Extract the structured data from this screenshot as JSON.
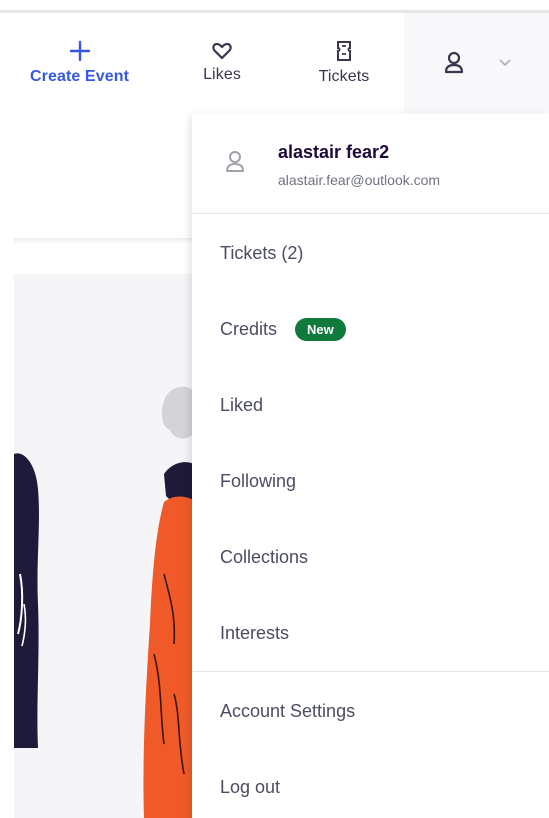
{
  "header": {
    "create_event": "Create Event",
    "likes": "Likes",
    "tickets": "Tickets"
  },
  "icons": {
    "create": "plus-icon",
    "likes": "heart-icon",
    "tickets": "ticket-icon",
    "profile": "user-icon",
    "chevron": "chevron-down-icon"
  },
  "colors": {
    "accent_blue": "#3659e3",
    "badge_green": "#0f7a3b",
    "figure_orange": "#f05a28",
    "figure_navy": "#1e1a3a"
  },
  "user": {
    "name": "alastair fear2",
    "email": "alastair.fear@outlook.com"
  },
  "menu": {
    "tickets": "Tickets (2)",
    "credits": "Credits",
    "credits_badge": "New",
    "liked": "Liked",
    "following": "Following",
    "collections": "Collections",
    "interests": "Interests",
    "account_settings": "Account Settings",
    "log_out": "Log out"
  }
}
